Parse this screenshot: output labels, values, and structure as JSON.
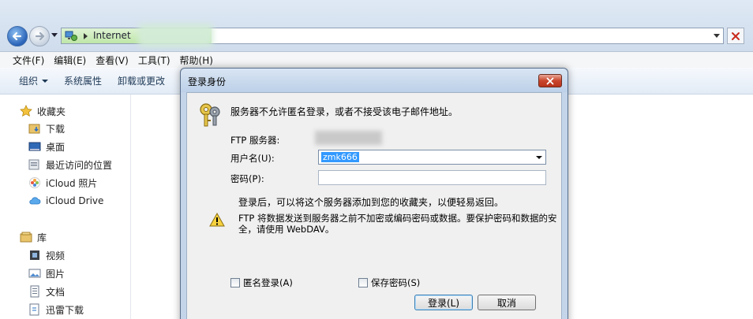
{
  "address_bar": {
    "location": "Internet",
    "icons": [
      "back-arrow-icon",
      "forward-arrow-icon",
      "network-icon",
      "stop-icon"
    ]
  },
  "menu": [
    "文件(F)",
    "编辑(E)",
    "查看(V)",
    "工具(T)",
    "帮助(H)"
  ],
  "commands": {
    "organize": "组织",
    "system_properties": "系统属性",
    "uninstall": "卸载或更改"
  },
  "sidebar": {
    "favorites_header": "收藏夹",
    "favorites": [
      "下载",
      "桌面",
      "最近访问的位置",
      "iCloud 照片",
      "iCloud Drive"
    ],
    "libraries_header": "库",
    "libraries": [
      "视频",
      "图片",
      "文档",
      "迅雷下载"
    ]
  },
  "dialog": {
    "title": "登录身份",
    "message": "服务器不允许匿名登录，或者不接受该电子邮件地址。",
    "ftp_server_label": "FTP 服务器:",
    "username_label": "用户名(U):",
    "username_value": "zmk666",
    "password_label": "密码(P):",
    "password_value": "",
    "note_login": "登录后，可以将这个服务器添加到您的收藏夹，以便轻易返回。",
    "warning": "FTP 将数据发送到服务器之前不加密或编码密码或数据。要保护密码和数据的安全，请使用 WebDAV。",
    "anonymous_label": "匿名登录(A)",
    "save_password_label": "保存密码(S)",
    "anonymous_checked": false,
    "save_password_checked": false,
    "login_button": "登录(L)",
    "cancel_button": "取消"
  }
}
